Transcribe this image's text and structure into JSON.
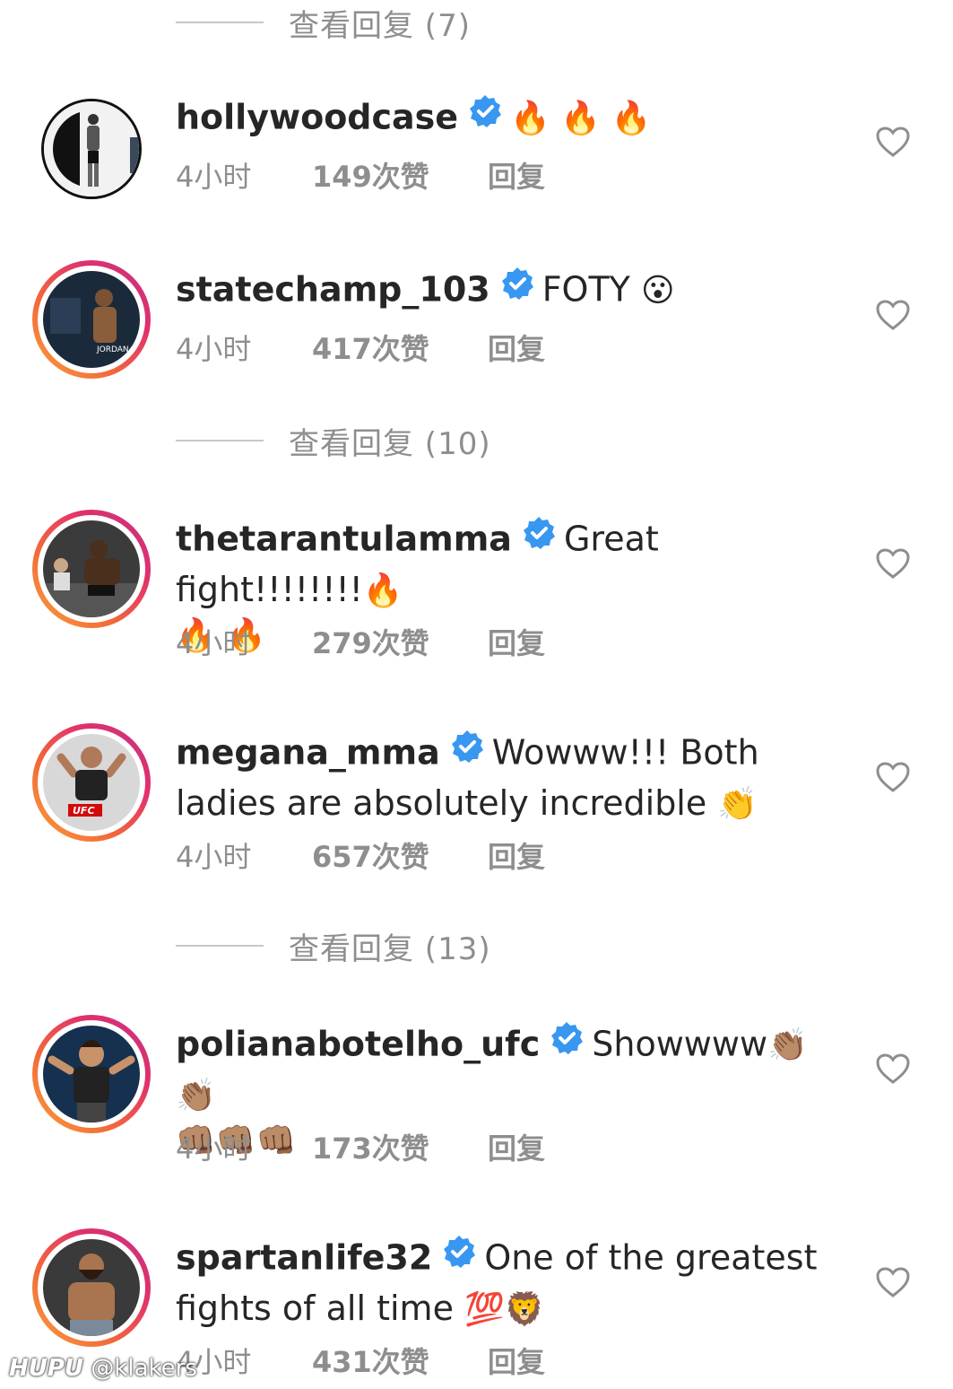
{
  "view_replies": [
    {
      "label": "查看回复 (7)"
    },
    {
      "label": "查看回复 (10)"
    },
    {
      "label": "查看回复 (13)"
    }
  ],
  "reply_label": "回复",
  "comments": [
    {
      "username": "hollywoodcase",
      "text_line1": "",
      "emoji_line1": "🔥 🔥 🔥",
      "text_line2": "",
      "emoji_line2": "",
      "time": "4小时",
      "likes": "149次赞"
    },
    {
      "username": "statechamp_103",
      "text_line1": "FOTY",
      "emoji_line1": "😮",
      "text_line2": "",
      "emoji_line2": "",
      "time": "4小时",
      "likes": "417次赞"
    },
    {
      "username": "thetarantulamma",
      "text_line1": "Great fight!!!!!!!!",
      "emoji_line1": "🔥",
      "text_line2": "",
      "emoji_line2": "🔥 🔥",
      "time": "4小时",
      "likes": "279次赞"
    },
    {
      "username": "megana_mma",
      "text_line1": "Wowww!!! Both",
      "emoji_line1": "",
      "text_line2": "ladies are absolutely incredible",
      "emoji_line2": "👏",
      "time": "4小时",
      "likes": "657次赞"
    },
    {
      "username": "polianabotelho_ufc",
      "text_line1": "Showwww",
      "emoji_line1": "👏🏽 👏🏽",
      "text_line2": "",
      "emoji_line2": "👊🏽👊🏽👊🏽",
      "time": "4小时",
      "likes": "173次赞"
    },
    {
      "username": "spartanlife32",
      "text_line1": "One of the greatest",
      "emoji_line1": "",
      "text_line2": "fights of all time",
      "emoji_line2": "💯🦁",
      "time": "4小时",
      "likes": "431次赞"
    }
  ],
  "watermark": {
    "brand": "HUPU",
    "handle": "@klakers"
  },
  "colors": {
    "text": "#262626",
    "muted": "#8e8e8e",
    "verified": "#3897f0",
    "ring_start": "#f9a13b",
    "ring_end": "#c13584"
  }
}
